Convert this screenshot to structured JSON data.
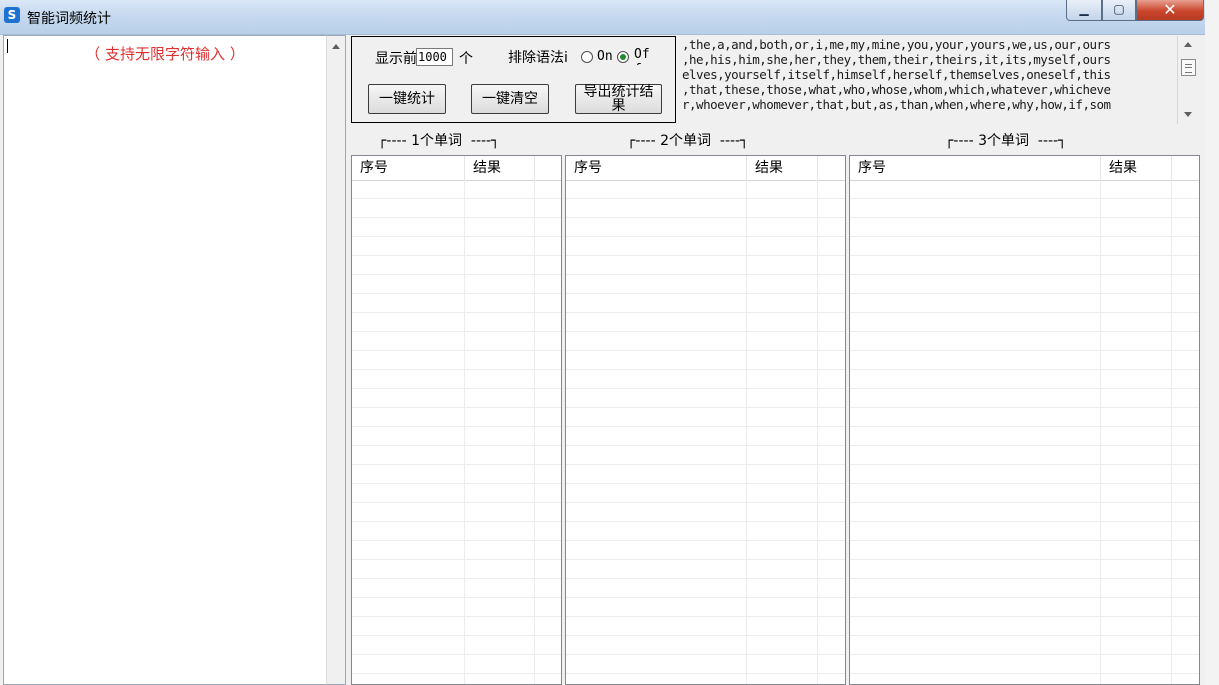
{
  "window": {
    "title": "智能词频统计",
    "icon_glyph": "S"
  },
  "caption_buttons": {
    "minimize": "▁",
    "maximize": "▢",
    "close": "✕"
  },
  "input": {
    "hint": "（ 支持无限字符输入 ）"
  },
  "controls": {
    "show_label": "显示前",
    "topn_value": "1000",
    "unit_label": "个",
    "exclude_label": "排除语法i",
    "radio_on_label": "On",
    "radio_off_label": "Of f",
    "selected": "off",
    "count_button": "一键统计",
    "clear_button": "一键清空",
    "export_button": "导出统计结果"
  },
  "stopwords": {
    "lines": [
      ",the,a,and,both,or,i,me,my,mine,you,your,yours,we,us,our,ours",
      ",he,his,him,she,her,they,them,their,theirs,it,its,myself,ours",
      "elves,yourself,itself,himself,herself,themselves,oneself,this",
      ",that,these,those,what,who,whose,whom,which,whatever,whicheve",
      "r,whoever,whomever,that,but,as,than,when,where,why,how,if,som"
    ]
  },
  "sections": [
    {
      "title": "┌---- 1个单词  ----┐"
    },
    {
      "title": "┌---- 2个单词  ----┐"
    },
    {
      "title": "┌---- 3个单词  ----┐"
    }
  ],
  "tables": [
    {
      "col_index": "序号",
      "col_result": "结果"
    },
    {
      "col_index": "序号",
      "col_result": "结果"
    },
    {
      "col_index": "序号",
      "col_result": "结果"
    }
  ],
  "colors": {
    "hint": "#e03131",
    "titlebar": "#c6d9ef",
    "close_button": "#c9462c",
    "radio_selected": "#1f8a2e"
  }
}
